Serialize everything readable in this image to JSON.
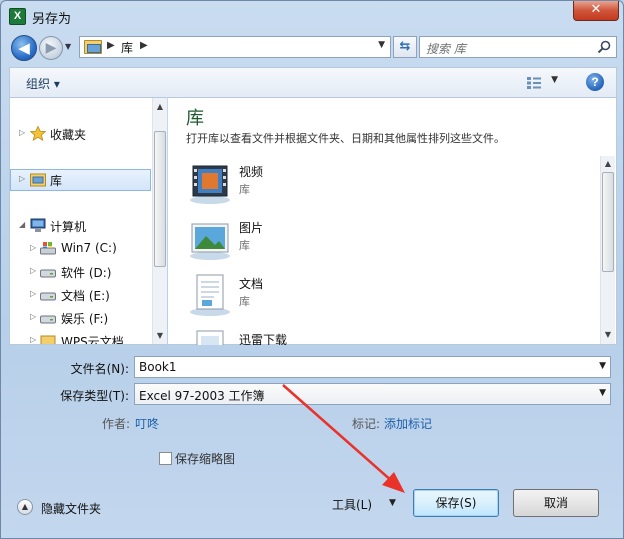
{
  "window": {
    "title": "另存为",
    "app_icon": "X",
    "close_glyph": "✕"
  },
  "nav": {
    "back_glyph": "◀",
    "forward_glyph": "▶",
    "address_separator": "▶",
    "address_location": "库",
    "search_placeholder": "搜索 库"
  },
  "toolbar": {
    "organize_label": "组织 ▾"
  },
  "sidebar": {
    "favorites": "收藏夹",
    "libraries": "库",
    "computer": "计算机",
    "drives": [
      {
        "label": "Win7 (C:)"
      },
      {
        "label": "软件 (D:)"
      },
      {
        "label": "文档 (E:)"
      },
      {
        "label": "娱乐 (F:)"
      },
      {
        "label": "WPS云文档"
      }
    ]
  },
  "content": {
    "title": "库",
    "description": "打开库以查看文件并根据文件夹、日期和其他属性排列这些文件。",
    "items": [
      {
        "name": "视频",
        "type": "库"
      },
      {
        "name": "图片",
        "type": "库"
      },
      {
        "name": "文档",
        "type": "库"
      },
      {
        "name": "迅雷下载",
        "type": ""
      }
    ]
  },
  "form": {
    "filename_label": "文件名(N):",
    "filename_value": "Book1",
    "filetype_label": "保存类型(T):",
    "filetype_value": "Excel 97-2003 工作簿",
    "author_label": "作者:",
    "author_value": "叮咚",
    "tags_label": "标记:",
    "tags_value": "添加标记",
    "thumbnail_label": "保存缩略图"
  },
  "footer": {
    "hide_folders": "隐藏文件夹",
    "tools": "工具(L)",
    "save": "保存(S)",
    "cancel": "取消"
  },
  "colors": {
    "annotation_arrow": "#e8322a",
    "accent": "#2a6fc9"
  }
}
